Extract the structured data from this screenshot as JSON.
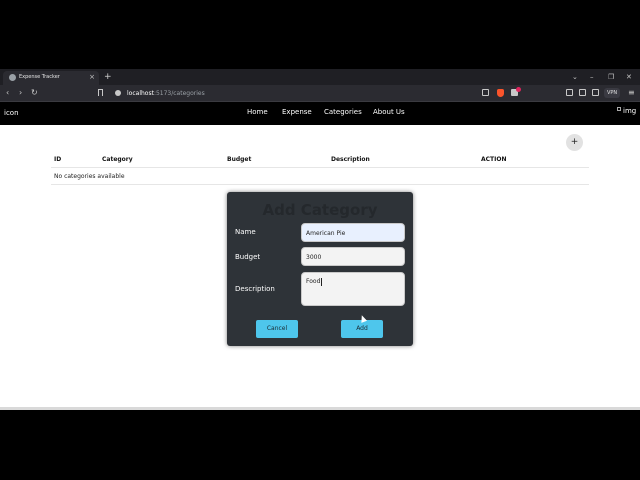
{
  "browser": {
    "tab_title": "Expense Tracker",
    "tab_close": "×",
    "new_tab": "+",
    "window_controls": [
      "⌄",
      "–",
      "❐",
      "✕"
    ],
    "nav_buttons": [
      "‹",
      "›",
      "↻"
    ],
    "url_host": "localhost",
    "url_path": ":5173/categories",
    "vpn_label": "VPN",
    "menu": "≡"
  },
  "appnav": {
    "logo": "icon",
    "links": [
      "Home",
      "Expense",
      "Categories",
      "About Us"
    ],
    "image_alt": "img"
  },
  "page": {
    "add_button": "+",
    "table": {
      "headers": [
        "ID",
        "Category",
        "Budget",
        "Description",
        "ACTION"
      ],
      "empty_message": "No categories available"
    }
  },
  "modal": {
    "title": "Add Category",
    "fields": {
      "name": {
        "label": "Name",
        "value": "American Pie"
      },
      "budget": {
        "label": "Budget",
        "value": "3000"
      },
      "description": {
        "label": "Description",
        "value": "Food"
      }
    },
    "cancel_label": "Cancel",
    "add_label": "Add"
  },
  "colors": {
    "modal_bg": "#2e3338",
    "button_bg": "#4ec6ec",
    "nav_bg": "#000000"
  }
}
